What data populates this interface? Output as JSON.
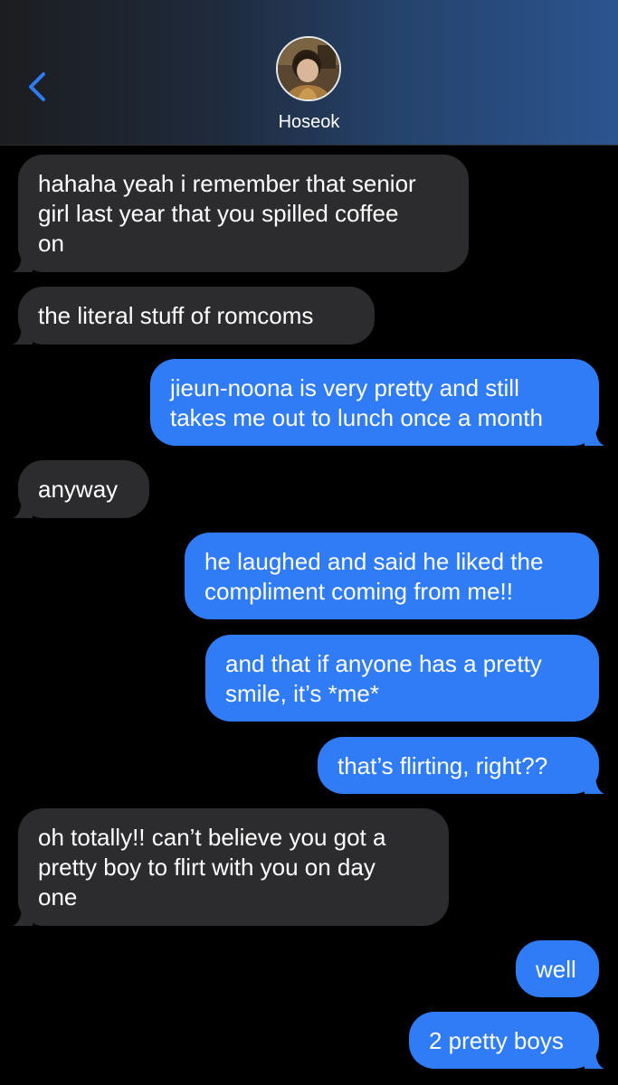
{
  "header": {
    "contact_name": "Hoseok",
    "back_icon": "chevron-left-icon",
    "accent_color": "#2f7cf6"
  },
  "messages": [
    {
      "from": "them",
      "text": "hahaha yeah i remember that senior\ngirl last year that you spilled coffee\non"
    },
    {
      "from": "them",
      "text": "the literal stuff of romcoms"
    },
    {
      "from": "me",
      "text": "jieun-noona is very pretty and still\ntakes me out to lunch once a month"
    },
    {
      "from": "them",
      "text": "anyway"
    },
    {
      "from": "me",
      "text": "he laughed and said he liked the\ncompliment coming from me!!"
    },
    {
      "from": "me",
      "text": "and that if anyone has a pretty\nsmile, it’s *me*"
    },
    {
      "from": "me",
      "text": "that’s flirting, right??"
    },
    {
      "from": "them",
      "text": "oh totally!! can’t believe you got a\npretty boy to flirt with you on day\none"
    },
    {
      "from": "me",
      "text": "well"
    },
    {
      "from": "me",
      "text": "2 pretty boys"
    }
  ],
  "colors": {
    "incoming_bubble": "#2c2c2e",
    "outgoing_bubble": "#2f7cf6",
    "background": "#000000"
  }
}
